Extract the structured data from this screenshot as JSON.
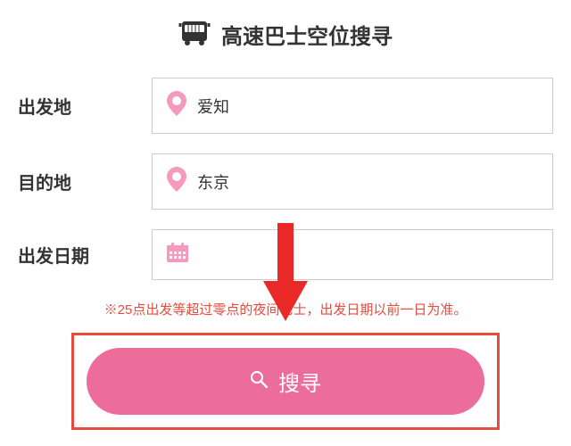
{
  "header": {
    "title": "高速巴士空位搜寻"
  },
  "form": {
    "origin": {
      "label": "出发地",
      "value": "爱知"
    },
    "destination": {
      "label": "目的地",
      "value": "东京"
    },
    "date": {
      "label": "出发日期",
      "value": ""
    }
  },
  "note": "※25点出发等超过零点的夜间巴士，出发日期以前一日为准。",
  "search": {
    "label": "搜寻"
  },
  "colors": {
    "accent": "#ec6d9a",
    "highlight": "#e74c3c"
  }
}
